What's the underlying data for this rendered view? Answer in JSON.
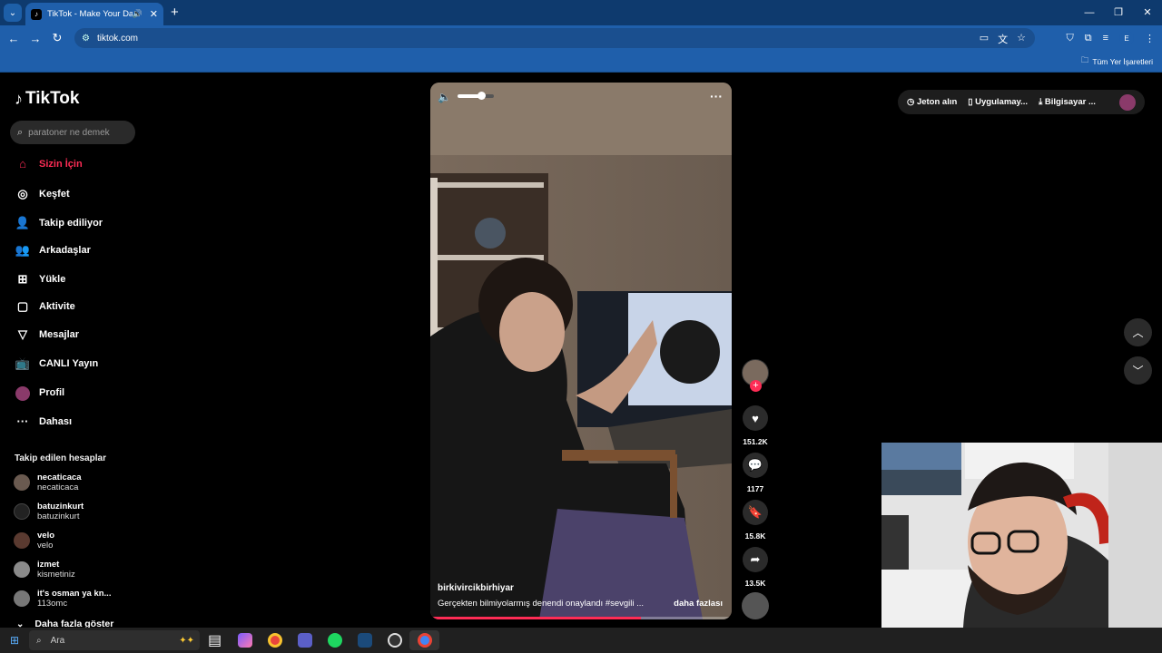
{
  "browser": {
    "tab_title": "TikTok - Make Your Day",
    "url": "tiktok.com",
    "bookmarks_label": "Tüm Yer İşaretleri"
  },
  "sidebar": {
    "logo_text": "TikTok",
    "search_placeholder": "paratoner ne demek",
    "nav": [
      {
        "label": "Sizin İçin",
        "icon": "home-icon"
      },
      {
        "label": "Keşfet",
        "icon": "compass-icon"
      },
      {
        "label": "Takip ediliyor",
        "icon": "user-follow-icon"
      },
      {
        "label": "Arkadaşlar",
        "icon": "friends-icon"
      },
      {
        "label": "Yükle",
        "icon": "upload-icon"
      },
      {
        "label": "Aktivite",
        "icon": "activity-icon"
      },
      {
        "label": "Mesajlar",
        "icon": "messages-icon"
      },
      {
        "label": "CANLI Yayın",
        "icon": "live-icon"
      },
      {
        "label": "Profil",
        "icon": "profile-avatar"
      },
      {
        "label": "Dahası",
        "icon": "more-icon"
      }
    ],
    "following_header": "Takip edilen hesaplar",
    "following": [
      {
        "name": "necaticaca",
        "handle": "necaticaca"
      },
      {
        "name": "batuzinkurt",
        "handle": "batuzinkurt"
      },
      {
        "name": "velo",
        "handle": "velo"
      },
      {
        "name": "izmet",
        "handle": "kismetiniz"
      },
      {
        "name": "it's osman ya kn...",
        "handle": "113omc"
      }
    ],
    "show_more": "Daha fazla göster"
  },
  "video": {
    "author": "birkivircikbirhiyar",
    "caption": "Gerçekten bilmiyolarmış denendi onaylandı  #sevgili  ...",
    "more_label": "daha fazlası",
    "volume_level": 0.65,
    "progress": 0.7
  },
  "actions": {
    "likes": "151.2K",
    "comments": "1177",
    "saves": "15.8K",
    "shares": "13.5K"
  },
  "topbar": {
    "coins": "Jeton alın",
    "app": "Uygulamay...",
    "pc": "Bilgisayar ..."
  },
  "taskbar": {
    "search": "Ara"
  }
}
